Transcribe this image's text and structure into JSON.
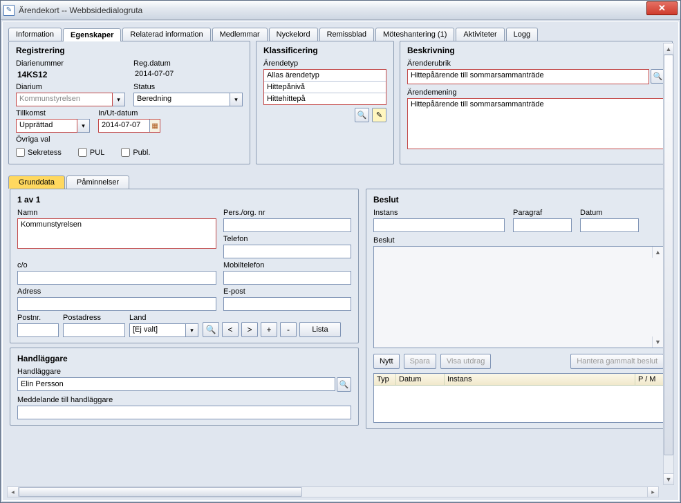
{
  "window": {
    "title": "Ärendekort -- Webbsidedialogruta"
  },
  "tabs": {
    "information": "Information",
    "egenskaper": "Egenskaper",
    "relaterad": "Relaterad information",
    "medlemmar": "Medlemmar",
    "nyckelord": "Nyckelord",
    "remissblad": "Remissblad",
    "moteshantering": "Möteshantering (1)",
    "aktiviteter": "Aktiviteter",
    "logg": "Logg"
  },
  "registrering": {
    "title": "Registrering",
    "diarienummer_lbl": "Diarienummer",
    "diarienummer": "14KS12",
    "regdatum_lbl": "Reg.datum",
    "regdatum": "2014-07-07",
    "diarium_lbl": "Diarium",
    "diarium": "Kommunstyrelsen",
    "status_lbl": "Status",
    "status": "Beredning",
    "tillkomst_lbl": "Tillkomst",
    "tillkomst": "Upprättad",
    "inut_lbl": "In/Ut-datum",
    "inut": "2014-07-07",
    "ovriga_lbl": "Övriga val",
    "sekretess": "Sekretess",
    "pul": "PUL",
    "publ": "Publ."
  },
  "klassificering": {
    "title": "Klassificering",
    "arendetyp_lbl": "Ärendetyp",
    "item1": "Allas ärendetyp",
    "item2": "Hittepånivå",
    "item3": "Hittehittepå"
  },
  "beskrivning": {
    "title": "Beskrivning",
    "rubrik_lbl": "Ärenderubrik",
    "rubrik": "Hittepåärende till sommarsammanträde",
    "mening_lbl": "Ärendemening",
    "mening": "Hittepåärende till sommarsammanträde"
  },
  "subtabs": {
    "grunddata": "Grunddata",
    "paminnelser": "Påminnelser"
  },
  "grund": {
    "counter": "1 av 1",
    "namn_lbl": "Namn",
    "namn": "Kommunstyrelsen",
    "persorg_lbl": "Pers./org. nr",
    "telefon_lbl": "Telefon",
    "co_lbl": "c/o",
    "mobil_lbl": "Mobiltelefon",
    "adress_lbl": "Adress",
    "epost_lbl": "E-post",
    "postnr_lbl": "Postnr.",
    "postadress_lbl": "Postadress",
    "land_lbl": "Land",
    "land": "[Ej valt]",
    "lista": "Lista"
  },
  "handlaggare": {
    "title": "Handläggare",
    "lbl": "Handläggare",
    "val": "Elin Persson",
    "meddelande_lbl": "Meddelande till handläggare"
  },
  "beslut": {
    "title": "Beslut",
    "instans_lbl": "Instans",
    "paragraf_lbl": "Paragraf",
    "datum_lbl": "Datum",
    "beslut_lbl": "Beslut",
    "nytt": "Nytt",
    "spara": "Spara",
    "visa": "Visa utdrag",
    "hantera": "Hantera gammalt beslut",
    "th_typ": "Typ",
    "th_datum": "Datum",
    "th_instans": "Instans",
    "th_pm": "P / M"
  }
}
